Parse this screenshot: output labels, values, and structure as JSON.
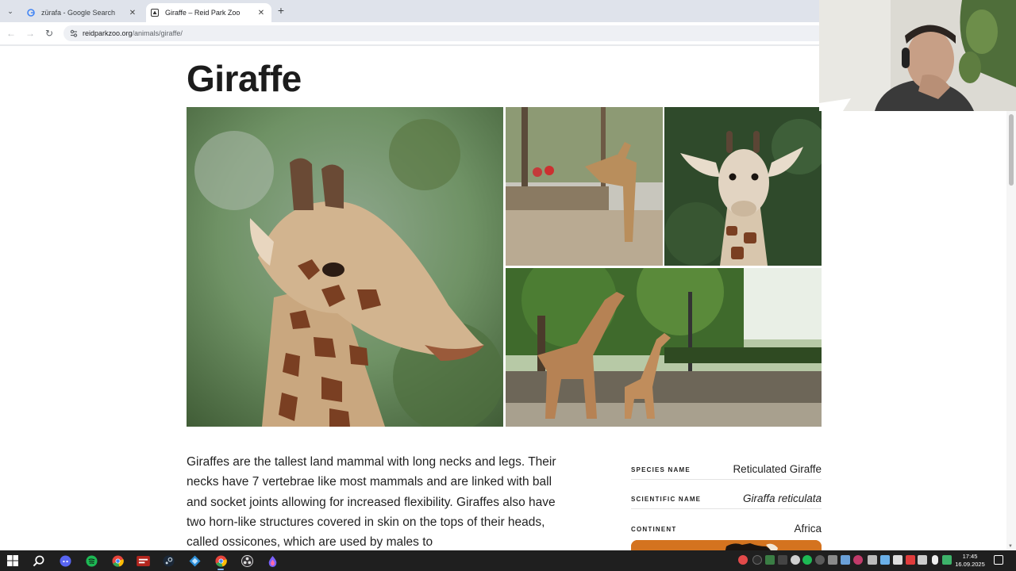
{
  "browser": {
    "tabs": [
      {
        "title": "zürafa - Google Search",
        "active": false
      },
      {
        "title": "Giraffe – Reid Park Zoo",
        "active": true
      }
    ],
    "url": {
      "domain": "reidparkzoo.org",
      "path": "/animals/giraffe/"
    },
    "icons": {
      "menu": "chevron-down-icon",
      "close": "close-icon",
      "new_tab": "plus-icon",
      "back": "back-arrow-icon",
      "forward": "forward-arrow-icon",
      "reload": "reload-icon"
    }
  },
  "page": {
    "title": "Giraffe",
    "intro": "Giraffes are the tallest land mammal with long necks and legs. Their necks have 7 vertebrae like most mammals and are linked with ball and socket joints allowing for increased flexibility. Giraffes also have two horn-like structures covered in skin on the tops of their heads, called ossicones, which are used by males to",
    "facts": [
      {
        "label": "SPECIES NAME",
        "value": "Reticulated Giraffe"
      },
      {
        "label": "SCIENTIFIC NAME",
        "value": "Giraffa reticulata"
      },
      {
        "label": "CONTINENT",
        "value": "Africa"
      }
    ]
  },
  "taskbar": {
    "time": "17:45",
    "date": "16.09.2025",
    "accent": "#7fb2f0"
  }
}
